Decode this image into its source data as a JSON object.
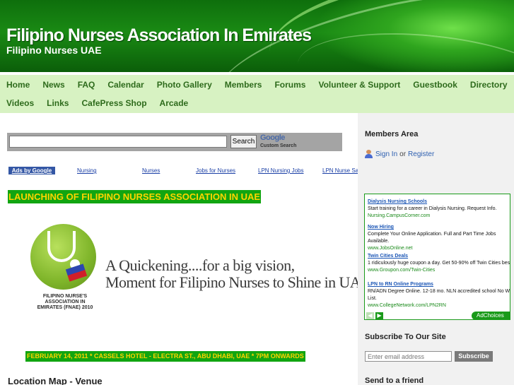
{
  "header": {
    "site_title": "Filipino Nurses Association In Emirates",
    "tagline": "Filipino Nurses UAE"
  },
  "nav": {
    "row1": [
      "Home",
      "News",
      "FAQ",
      "Calendar",
      "Photo Gallery",
      "Members",
      "Forums",
      "Volunteer & Support",
      "Guestbook",
      "Directory"
    ],
    "row2": [
      "Videos",
      "Links",
      "CafePress Shop",
      "Arcade"
    ]
  },
  "search": {
    "button_label": "Search",
    "google_logo": "Google",
    "custom_search_label": "Custom Search"
  },
  "ads_row": {
    "badge": "Ads by Google",
    "links": [
      "Nursing",
      "Nurses",
      "Jobs for Nurses",
      "LPN Nursing Jobs",
      "LPN Nurse Sa"
    ]
  },
  "post": {
    "title": "LAUNCHING OF FILIPINO NURSES ASSOCIATION IN UAE",
    "banner_line1": "A Quickening....for a big vision,",
    "banner_line2": "Moment for Filipino Nurses to Shine in UAE.",
    "logo_caption_line1": "FILIPINO NURSE'S",
    "logo_caption_line2": "ASSOCIATION IN",
    "logo_caption_line3": "EMIRATES (FNAE) 2010",
    "event_details": "FEBRUARY 14, 2011 * CASSELS HOTEL - ELECTRA ST., ABU DHABI, UAE * 7PM ONWARDS",
    "next_section": "Location Map - Venue"
  },
  "sidebar": {
    "members_area": {
      "heading": "Members Area",
      "sign_in": "Sign In",
      "or": "or",
      "register": "Register"
    },
    "ads": [
      {
        "title": "Dialysis Nursing Schools",
        "desc": "Start training for a career in Dialysis Nursing. Request Info.",
        "url": "Nursing.CampusCorner.com"
      },
      {
        "title": "Now Hiring",
        "desc": "Complete Your Online Application. Full and Part Time Jobs Available.",
        "url": "www.JobsOnline.net"
      },
      {
        "title": "Twin Cities Deals",
        "desc": "1 ridiculously huge coupon a day. Get 50-90% off Twin Cities best!",
        "url": "www.Groupon.com/Twin-Cities"
      },
      {
        "title": "LPN to RN Online Programs",
        "desc": "RN/ADN Degree Online. 12-18 mo. NLN accredited school No Wait List.",
        "url": "www.CollegeNetwork.com/LPN2RN"
      }
    ],
    "adchoices": "AdChoices",
    "subscribe": {
      "heading": "Subscribe To Our Site",
      "placeholder": "Enter email address",
      "button_label": "Subscribe"
    },
    "send_to_friend": "Send to a friend"
  },
  "colors": {
    "header_green": "#1a8a14",
    "nav_bg": "#d7f2c2",
    "nav_text": "#2e6b1c",
    "highlight_green": "#11a511",
    "highlight_text": "#ffd400",
    "link_blue": "#2d5fb0"
  },
  "icons": {
    "user": "user-icon",
    "prev": "chevron-left-icon",
    "next": "chevron-right-icon"
  }
}
